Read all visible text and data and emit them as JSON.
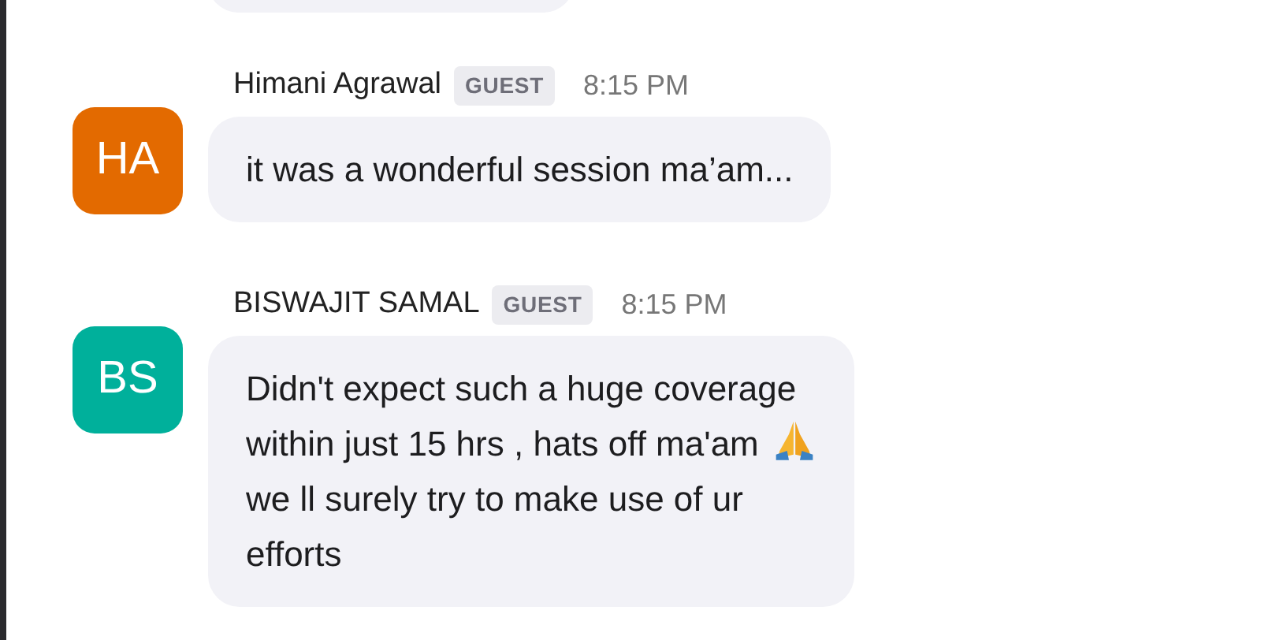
{
  "messages": [
    {
      "initials": "HA",
      "color": "#e36a00",
      "sender": "Himani Agrawal",
      "badge": "GUEST",
      "time": "8:15 PM",
      "body": [
        {
          "kind": "text",
          "text": "it was a wonderful session ma’am..."
        }
      ]
    },
    {
      "initials": "BS",
      "color": "#00b09b",
      "sender": "BISWAJIT SAMAL",
      "badge": "GUEST",
      "time": "8:15 PM",
      "body": [
        {
          "kind": "text",
          "text": "Didn't expect such a huge coverage within just 15 hrs , hats off ma'am "
        },
        {
          "kind": "emoji"
        },
        {
          "kind": "text",
          "text": " we ll surely try to make use of ur efforts"
        }
      ]
    }
  ]
}
